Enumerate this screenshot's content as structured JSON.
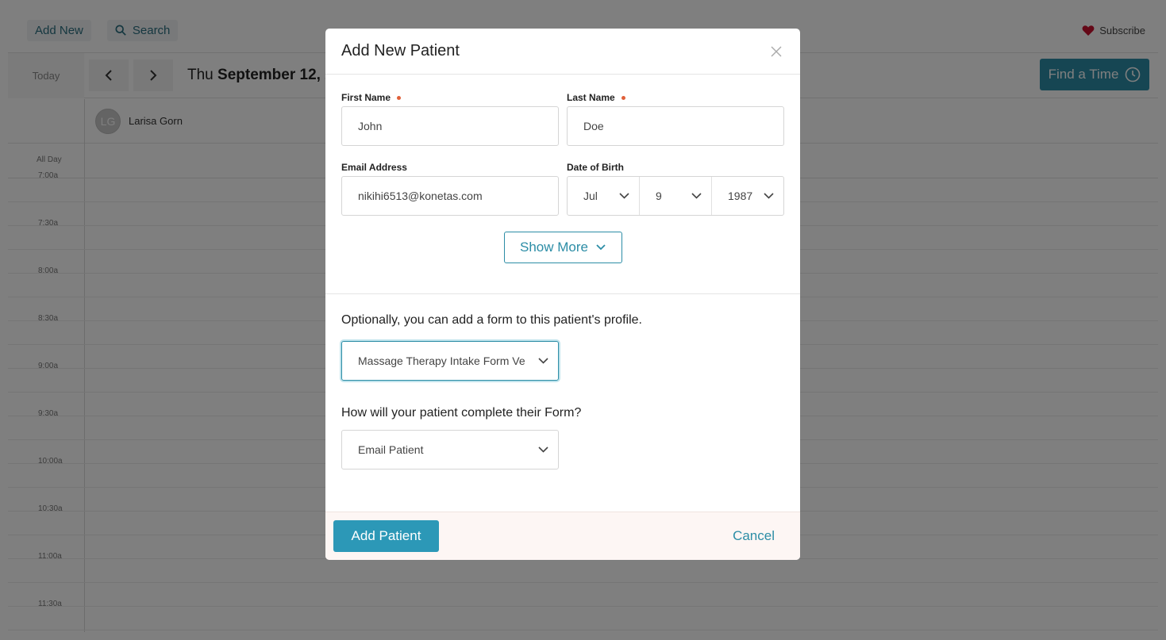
{
  "topbar": {
    "add_new_label": "Add New",
    "search_label": "Search",
    "subscribe_label": "Subscribe"
  },
  "datebar": {
    "today_label": "Today",
    "date_prefix": "Thu",
    "date_bold": "September 12, 2",
    "find_time_label": "Find a Time"
  },
  "calendar": {
    "staff_initials": "LG",
    "staff_name": "Larisa Gorn",
    "all_day_label": "All Day",
    "times": [
      "7:00a",
      "7:30a",
      "8:00a",
      "8:30a",
      "9:00a",
      "9:30a",
      "10:00a",
      "10:30a",
      "11:00a",
      "11:30a"
    ]
  },
  "modal": {
    "title": "Add New Patient",
    "first_name_label": "First Name",
    "first_name_value": "John",
    "last_name_label": "Last Name",
    "last_name_value": "Doe",
    "email_label": "Email Address",
    "email_value": "nikihi6513@konetas.com",
    "dob_label": "Date of Birth",
    "dob_month": "Jul",
    "dob_day": "9",
    "dob_year": "1987",
    "show_more_label": "Show More",
    "form_question": "Optionally, you can add a form to this patient's profile.",
    "form_selected": "Massage Therapy Intake Form Ve",
    "complete_question": "How will your patient complete their Form?",
    "complete_selected": "Email Patient",
    "add_patient_label": "Add Patient",
    "cancel_label": "Cancel"
  },
  "colors": {
    "accent": "#2c8da6",
    "required_dot": "#e0603a",
    "heart": "#c8102e"
  }
}
